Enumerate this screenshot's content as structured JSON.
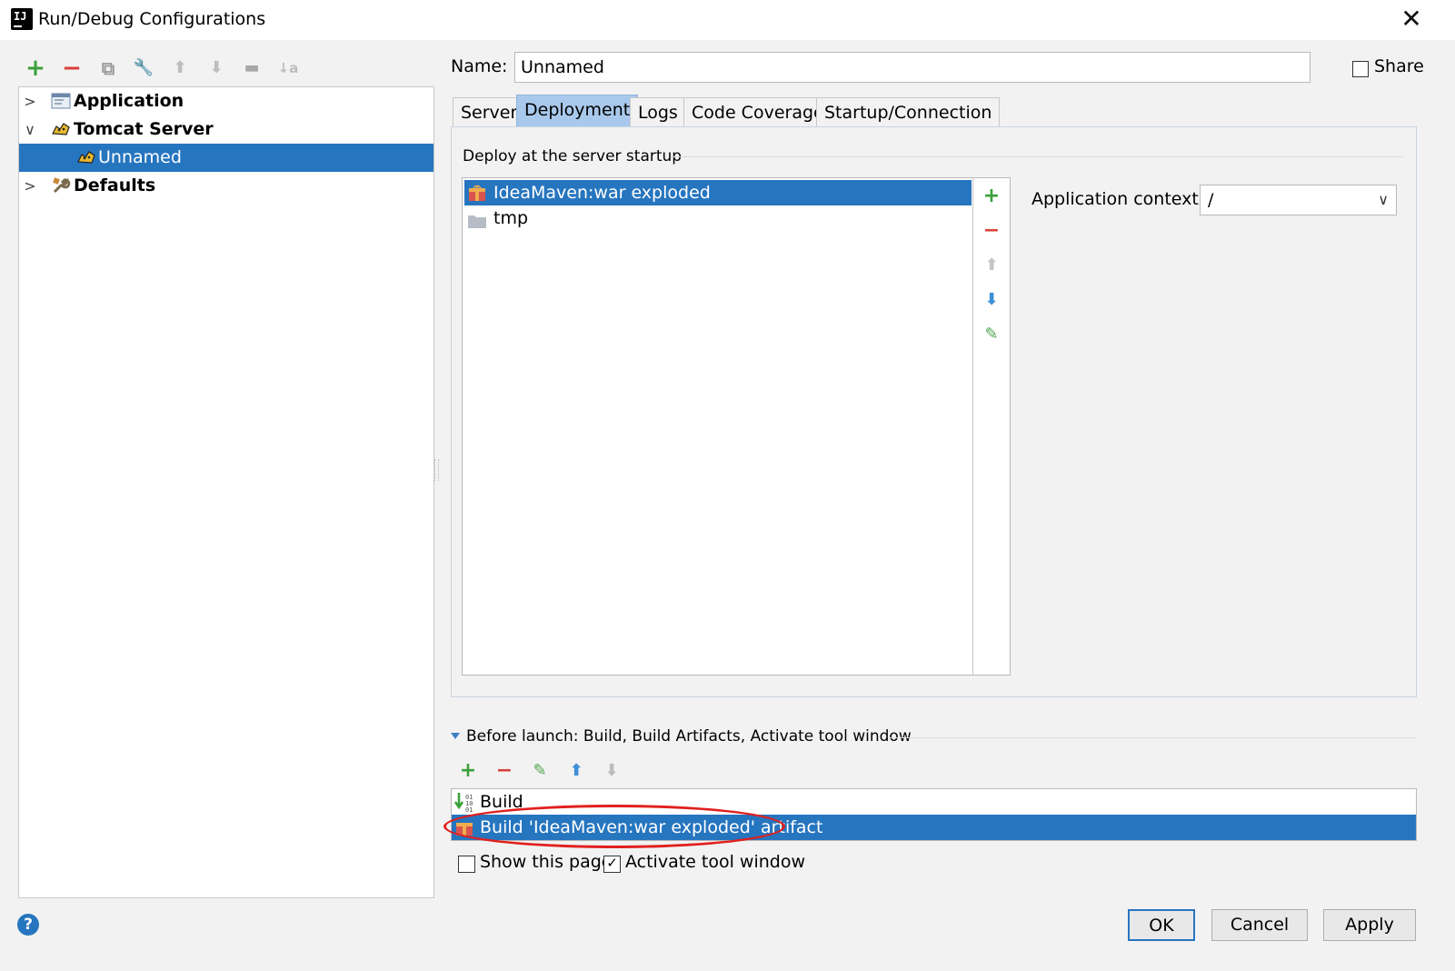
{
  "window": {
    "title": "Run/Debug Configurations",
    "logo_text": "IJ"
  },
  "left_toolbar": {
    "add": "+",
    "remove": "−",
    "copy": "⧉",
    "edit_defaults": "🔧",
    "move_up": "⬆",
    "move_down": "⬇",
    "folder": "▬",
    "sort": "↓a"
  },
  "tree": {
    "items": [
      {
        "label": "Application",
        "expanded": false
      },
      {
        "label": "Tomcat Server",
        "expanded": true
      },
      {
        "label": "Unnamed",
        "selected": true
      },
      {
        "label": "Defaults",
        "expanded": false
      }
    ]
  },
  "name": {
    "label": "Name:",
    "value": "Unnamed"
  },
  "share": {
    "label": "Share",
    "checked": false
  },
  "tabs": [
    {
      "label": "Server"
    },
    {
      "label": "Deployment",
      "active": true
    },
    {
      "label": "Logs"
    },
    {
      "label": "Code Coverage"
    },
    {
      "label": "Startup/Connection"
    }
  ],
  "deployment": {
    "section_title": "Deploy at the server startup",
    "artifacts": [
      {
        "label": "IdeaMaven:war exploded",
        "selected": true
      },
      {
        "label": "tmp"
      }
    ],
    "context_label": "Application context:",
    "context_value": "/"
  },
  "before_launch": {
    "title": "Before launch: Build, Build Artifacts, Activate tool window",
    "items": [
      {
        "label": "Build"
      },
      {
        "label": "Build 'IdeaMaven:war exploded' artifact",
        "selected": true
      }
    ],
    "show_page_label": "Show this page",
    "show_page_checked": false,
    "activate_label": "Activate tool window",
    "activate_checked": true
  },
  "buttons": {
    "ok": "OK",
    "cancel": "Cancel",
    "apply": "Apply",
    "help": "?"
  },
  "colors": {
    "selection": "#2675bf",
    "active_tab": "#a9c9ec",
    "annotation": "#e0201e",
    "add": "#3aa03a",
    "remove": "#d9403a"
  }
}
